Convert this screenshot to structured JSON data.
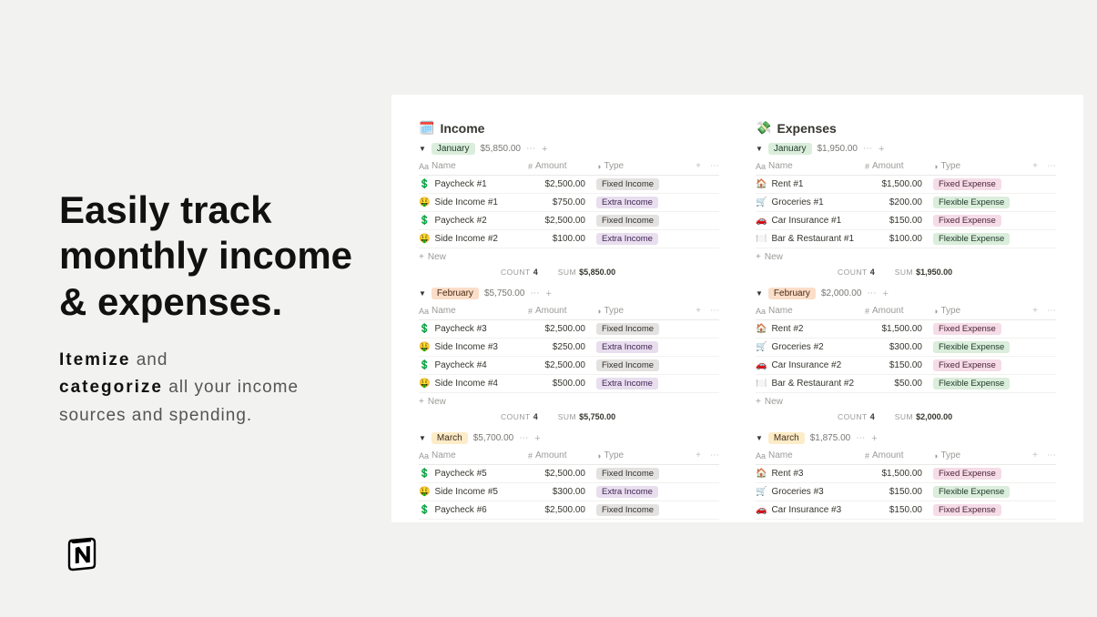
{
  "marketing": {
    "headline": "Easily track monthly income & expenses.",
    "sub1_bold": "Itemize",
    "sub1_rest": " and ",
    "sub2_bold": "categorize",
    "sub2_rest": " all your income sources and spending."
  },
  "labels": {
    "name_col": "Name",
    "amount_col": "Amount",
    "type_col": "Type",
    "new": "New",
    "count": "COUNT",
    "sum": "SUM"
  },
  "income": {
    "title": "Income",
    "groups": [
      {
        "month": "January",
        "month_class": "month-jan",
        "total": "$5,850.00",
        "rows": [
          {
            "icon": "💲",
            "name": "Paycheck #1",
            "amount": "$2,500.00",
            "type": "Fixed Income",
            "type_class": "tag-fixed-income"
          },
          {
            "icon": "🤑",
            "name": "Side Income #1",
            "amount": "$750.00",
            "type": "Extra Income",
            "type_class": "tag-extra-income"
          },
          {
            "icon": "💲",
            "name": "Paycheck #2",
            "amount": "$2,500.00",
            "type": "Fixed Income",
            "type_class": "tag-fixed-income"
          },
          {
            "icon": "🤑",
            "name": "Side Income #2",
            "amount": "$100.00",
            "type": "Extra Income",
            "type_class": "tag-extra-income"
          }
        ],
        "count": "4",
        "sum": "$5,850.00"
      },
      {
        "month": "February",
        "month_class": "month-feb",
        "total": "$5,750.00",
        "rows": [
          {
            "icon": "💲",
            "name": "Paycheck #3",
            "amount": "$2,500.00",
            "type": "Fixed Income",
            "type_class": "tag-fixed-income"
          },
          {
            "icon": "🤑",
            "name": "Side Income #3",
            "amount": "$250.00",
            "type": "Extra Income",
            "type_class": "tag-extra-income"
          },
          {
            "icon": "💲",
            "name": "Paycheck #4",
            "amount": "$2,500.00",
            "type": "Fixed Income",
            "type_class": "tag-fixed-income"
          },
          {
            "icon": "🤑",
            "name": "Side Income #4",
            "amount": "$500.00",
            "type": "Extra Income",
            "type_class": "tag-extra-income"
          }
        ],
        "count": "4",
        "sum": "$5,750.00"
      },
      {
        "month": "March",
        "month_class": "month-mar",
        "total": "$5,700.00",
        "rows": [
          {
            "icon": "💲",
            "name": "Paycheck #5",
            "amount": "$2,500.00",
            "type": "Fixed Income",
            "type_class": "tag-fixed-income"
          },
          {
            "icon": "🤑",
            "name": "Side Income #5",
            "amount": "$300.00",
            "type": "Extra Income",
            "type_class": "tag-extra-income"
          },
          {
            "icon": "💲",
            "name": "Paycheck #6",
            "amount": "$2,500.00",
            "type": "Fixed Income",
            "type_class": "tag-fixed-income"
          }
        ],
        "partial": true
      }
    ]
  },
  "expenses": {
    "title": "Expenses",
    "groups": [
      {
        "month": "January",
        "month_class": "month-jan",
        "total": "$1,950.00",
        "rows": [
          {
            "icon": "🏠",
            "name": "Rent #1",
            "amount": "$1,500.00",
            "type": "Fixed Expense",
            "type_class": "tag-fixed-expense"
          },
          {
            "icon": "🛒",
            "name": "Groceries #1",
            "amount": "$200.00",
            "type": "Flexible Expense",
            "type_class": "tag-flexible-expense"
          },
          {
            "icon": "🚗",
            "name": "Car Insurance #1",
            "amount": "$150.00",
            "type": "Fixed Expense",
            "type_class": "tag-fixed-expense"
          },
          {
            "icon": "🍽️",
            "name": "Bar & Restaurant #1",
            "amount": "$100.00",
            "type": "Flexible Expense",
            "type_class": "tag-flexible-expense"
          }
        ],
        "count": "4",
        "sum": "$1,950.00"
      },
      {
        "month": "February",
        "month_class": "month-feb",
        "total": "$2,000.00",
        "rows": [
          {
            "icon": "🏠",
            "name": "Rent #2",
            "amount": "$1,500.00",
            "type": "Fixed Expense",
            "type_class": "tag-fixed-expense"
          },
          {
            "icon": "🛒",
            "name": "Groceries #2",
            "amount": "$300.00",
            "type": "Flexible Expense",
            "type_class": "tag-flexible-expense"
          },
          {
            "icon": "🚗",
            "name": "Car Insurance #2",
            "amount": "$150.00",
            "type": "Fixed Expense",
            "type_class": "tag-fixed-expense"
          },
          {
            "icon": "🍽️",
            "name": "Bar & Restaurant #2",
            "amount": "$50.00",
            "type": "Flexible Expense",
            "type_class": "tag-flexible-expense"
          }
        ],
        "count": "4",
        "sum": "$2,000.00"
      },
      {
        "month": "March",
        "month_class": "month-mar",
        "total": "$1,875.00",
        "rows": [
          {
            "icon": "🏠",
            "name": "Rent #3",
            "amount": "$1,500.00",
            "type": "Fixed Expense",
            "type_class": "tag-fixed-expense"
          },
          {
            "icon": "🛒",
            "name": "Groceries #3",
            "amount": "$150.00",
            "type": "Flexible Expense",
            "type_class": "tag-flexible-expense"
          },
          {
            "icon": "🚗",
            "name": "Car Insurance #3",
            "amount": "$150.00",
            "type": "Fixed Expense",
            "type_class": "tag-fixed-expense"
          }
        ],
        "partial": true
      }
    ]
  }
}
